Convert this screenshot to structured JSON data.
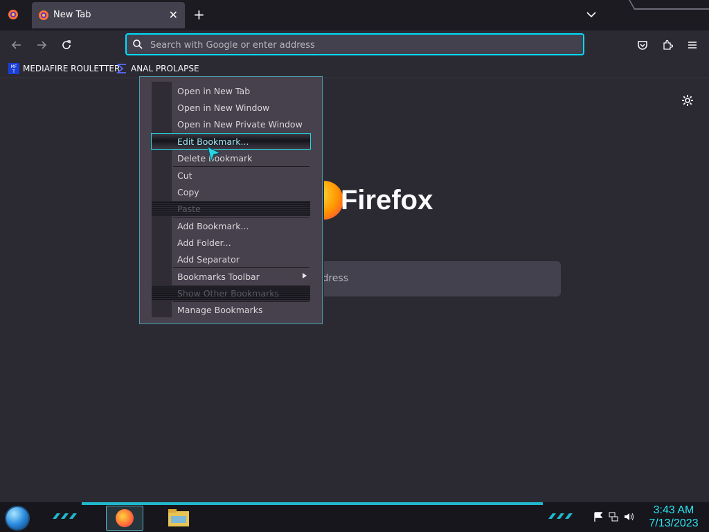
{
  "browser": {
    "tab": {
      "title": "New Tab"
    },
    "urlbar": {
      "placeholder": "Search with Google or enter address"
    },
    "bookmarks": [
      {
        "label": "MEDIAFIRE ROULETTER",
        "favicon_text": "MF T"
      },
      {
        "label": "ANAL PROLAPSE"
      }
    ],
    "accent_color": "#00ddff"
  },
  "newtab": {
    "brand": "Firefox",
    "search_hint": "ddress"
  },
  "context_menu": {
    "items": [
      {
        "label": "Open in New Tab",
        "state": "normal"
      },
      {
        "label": "Open in New Window",
        "state": "normal"
      },
      {
        "label": "Open in New Private Window",
        "state": "normal"
      },
      {
        "label": "Edit Bookmark...",
        "state": "highlighted"
      },
      {
        "label": "Delete Bookmark",
        "state": "normal"
      },
      {
        "label": "Cut",
        "state": "normal"
      },
      {
        "label": "Copy",
        "state": "normal"
      },
      {
        "label": "Paste",
        "state": "disabled"
      },
      {
        "label": "Add Bookmark...",
        "state": "normal"
      },
      {
        "label": "Add Folder...",
        "state": "normal"
      },
      {
        "label": "Add Separator",
        "state": "normal"
      },
      {
        "label": "Bookmarks Toolbar",
        "state": "submenu"
      },
      {
        "label": "Show Other Bookmarks",
        "state": "disabled"
      },
      {
        "label": "Manage Bookmarks",
        "state": "normal"
      }
    ]
  },
  "taskbar": {
    "clock_time": "3:43 AM",
    "clock_date": "7/13/2023"
  }
}
